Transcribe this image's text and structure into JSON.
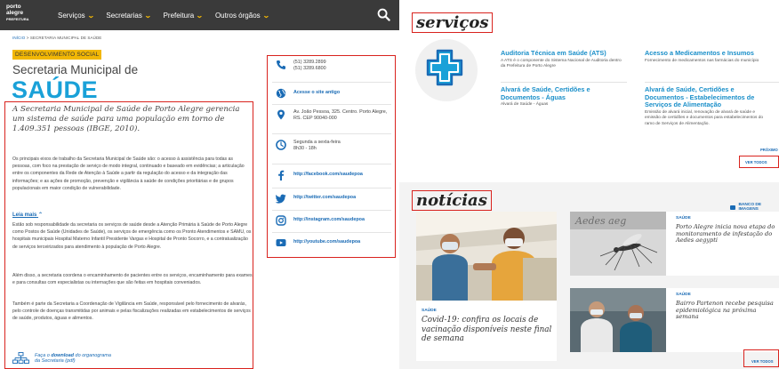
{
  "header": {
    "logo_lines": [
      "porto",
      "alegre",
      "PREFEITURA"
    ],
    "nav": [
      "Serviços",
      "Secretarias",
      "Prefeitura",
      "Outros órgãos"
    ]
  },
  "breadcrumb": {
    "home": "INÍCIO",
    "sep": ">",
    "current": "SECRETARIA MUNICIPAL DE SAÚDE"
  },
  "tag": "DESENVOLVIMENTO SOCIAL",
  "dept": {
    "small": "Secretaria Municipal de",
    "big": "SAÚDE"
  },
  "intro": "A Secretaria Municipal de Saúde de Porto Alegre gerencia um sistema de saúde para uma população em torno de 1.409.351 pessoas (IBGE, 2010).",
  "paragraphs": {
    "p1": "Os principais eixos de trabalho da Secretaria Municipal de Saúde são: o acesso à assistência para todas as pessoas, com foco na prestação de serviço de modo integral, continuado e baseado em evidências; a articulação entre os componentes da Rede de Atenção à Saúde a partir da regulação do acesso e da integração das informações; e as ações de promoção, prevenção e vigilância à saúde de condições prioritárias e de grupos populacionais em maior condição de vulnerabilidade.",
    "leia_mais": "Leia mais",
    "p2": "Estão sob responsabilidade da secretaria os serviços de saúde desde a Atenção Primária à Saúde de Porto Alegre como Postos de Saúde (Unidades de Saúde), os serviços de emergência como os Pronto Atendimentos e SAMU, os hospitais municipais Hospital Materno Infantil Presidente Vargas e Hospital de Pronto Socorro, e a contratualização de serviços terceirizados para atendimento à população de Porto Alegre.",
    "p3": "Além disso, a secretaria coordena o encaminhamento de pacientes entre os serviços, encaminhamento para exames e para consultas com especialistas ou internações que são feitas em hospitais conveniados.",
    "p4": "Também é parte da Secretaria a Coordenação de Vigilância em Saúde, responsável pelo fornecimento de alvarás, pelo controle de doenças transmitidas por animais e pelas fiscalizações realizadas em estabelecimentos de serviços de saúde, produtos, águas e alimentos."
  },
  "org_link": {
    "prefix": "Faça o ",
    "bold": "download",
    "suffix": " do organograma",
    "line2": "da Secretaria (pdf)"
  },
  "contact": {
    "phone1": "(51) 3289.2899",
    "phone2": "(51) 3289.6800",
    "old_site": "Acesse o site antigo",
    "address1": "Av. João Pessoa, 325. Centro. Porto Alegre,",
    "address2": "RS. CEP 90040-000",
    "hours1": "Segunda a sexta-feira",
    "hours2": "8h30 - 18h",
    "facebook": "http://facebook.com/saudepoa",
    "twitter": "http://twitter.com/saudepoa",
    "instagram": "http://instagram.com/saudepoa",
    "youtube": "http://youtube.com/saudepoa"
  },
  "servicos": {
    "title": "serviços",
    "items": [
      {
        "title": "Auditoria Técnica em Saúde (ATS)",
        "desc": "A ATS é o componente do Sistema Nacional de Auditoria dentro da Prefeitura de Porto Alegre"
      },
      {
        "title": "Acesso a Medicamentos e Insumos",
        "desc": "Fornecimento de medicamentos nas farmácias do município"
      },
      {
        "title": "Alvará de Saúde, Certidões e Documentos - Águas",
        "desc": "Alvará de Saúde - Águas"
      },
      {
        "title": "Alvará de Saúde, Certidões e Documentos - Estabelecimentos de Serviços de Alimentação",
        "desc": "Emissão de alvará inicial, renovação de alvará de saúde e emissão de certidões e documentos para estabelecimentos do ramo de Serviços de Alimentação."
      }
    ],
    "proximo": "PRÓXIMO",
    "ver_todos": "VER TODOS"
  },
  "noticias": {
    "title": "notícias",
    "banco": "BANCO DE IMAGENS",
    "main": {
      "cat": "SAÚDE",
      "title": "Covid-19: confira os locais de vacinação disponíveis neste final de semana"
    },
    "side": [
      {
        "cat": "SAÚDE",
        "title": "Porto Alegre inicia nova etapa do monitoramento de infestação do Aedes aegypti"
      },
      {
        "cat": "SAÚDE",
        "title": "Bairro Partenon recebe pesquisa epidemiológica na próxima semana"
      }
    ],
    "ver_todos": "VER TODOS"
  },
  "colors": {
    "accent_blue": "#1aa1d8",
    "link_blue": "#1a6bb5",
    "yellow": "#f2b705",
    "highlight_red": "#d9231e",
    "nav_bg": "#3a3a3a"
  }
}
